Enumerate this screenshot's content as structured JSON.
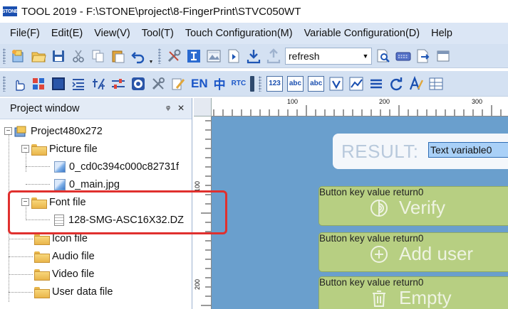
{
  "window": {
    "app_icon_text": "STONE",
    "title": "TOOL 2019 - F:\\STONE\\project\\8-FingerPrint\\STVC050WT"
  },
  "menu": [
    "File(F)",
    "Edit(E)",
    "View(V)",
    "Tool(T)",
    "Touch Configuration(M)",
    "Variable Configuration(D)",
    "Help"
  ],
  "toolbar1": {
    "combo_value": "refresh"
  },
  "toolbar2": {
    "en_label": "EN",
    "zh_label": "中",
    "rtc_label": "RTC",
    "num_label": "123",
    "abc1_label": "abc",
    "abc2_label": "abc"
  },
  "project_window": {
    "title": "Project window",
    "pin_glyph": "ᵠ",
    "close_glyph": "×",
    "tree": {
      "root": "Project480x272",
      "picture_folder": "Picture file",
      "picture_items": [
        "0_cd0c394c000c82731f",
        "0_main.jpg"
      ],
      "font_folder": "Font file",
      "font_items": [
        "128-SMG-ASC16X32.DZ"
      ],
      "icon_folder": "Icon file",
      "audio_folder": "Audio file",
      "video_folder": "Video file",
      "userdata_folder": "User data file"
    }
  },
  "ruler": {
    "h_labels": [
      "100",
      "200",
      "300"
    ],
    "v_labels": [
      "100",
      "200"
    ]
  },
  "canvas": {
    "result_label": "RESULT:",
    "text_variable": "Text variable0",
    "buttons": [
      {
        "caption": "Button key value return0",
        "label": "Verify",
        "icon": "fingerprint-icon"
      },
      {
        "caption": "Button key value return0",
        "label": "Add user",
        "icon": "plus-circle-icon"
      },
      {
        "caption": "Button key value return0",
        "label": "Empty",
        "icon": "trash-icon"
      }
    ]
  },
  "colors": {
    "canvas_bg": "#6a9fcd",
    "button_bg": "#b7cf82",
    "highlight": "#e0302e",
    "menubar": "#dbe6f5"
  }
}
